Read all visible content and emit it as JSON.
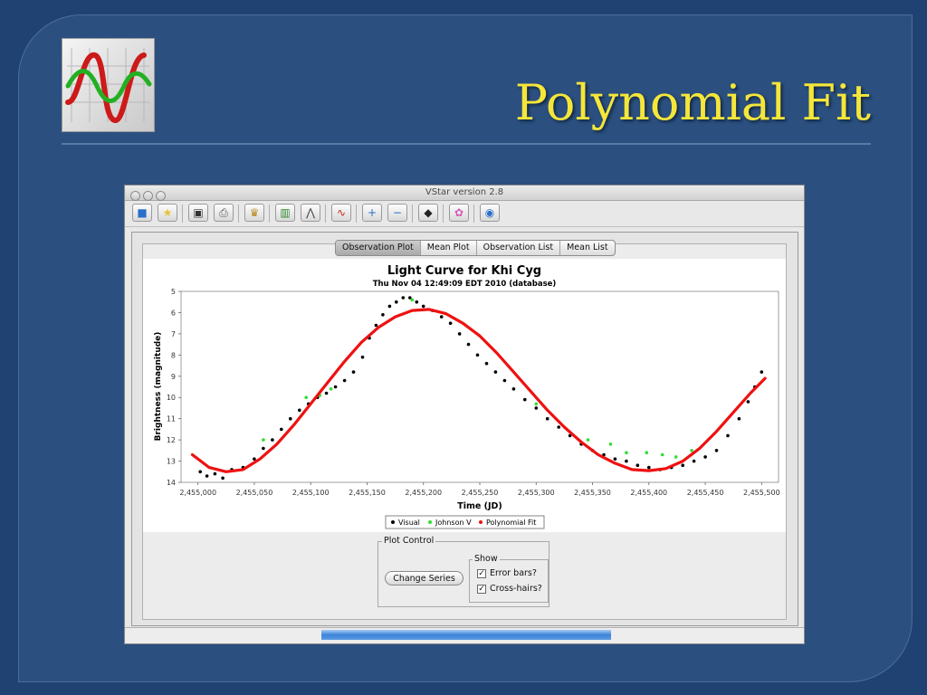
{
  "slide": {
    "title": "Polynomial Fit",
    "logo_icon": "sine-waves-chart-icon"
  },
  "window": {
    "title": "VStar version 2.8",
    "toolbar_icons": [
      "new-star-icon",
      "open-folder-icon",
      "save-icon",
      "print-icon",
      "info-icon",
      "mean-plot-icon",
      "polynomial-icon",
      "wave-icon",
      "zoom-in-icon",
      "zoom-out-icon",
      "filter-icon",
      "plugin-icon",
      "web-icon"
    ],
    "tabs": [
      {
        "label": "Observation Plot",
        "active": true
      },
      {
        "label": "Mean Plot",
        "active": false
      },
      {
        "label": "Observation List",
        "active": false
      },
      {
        "label": "Mean List",
        "active": false
      }
    ],
    "plot_control": {
      "title": "Plot Control",
      "change_series_label": "Change Series",
      "show_title": "Show",
      "error_bars_label": "Error bars?",
      "error_bars_checked": true,
      "cross_hairs_label": "Cross-hairs?",
      "cross_hairs_checked": true
    },
    "progress_fraction": 1.0
  },
  "chart_data": {
    "type": "scatter",
    "title": "Light Curve for Khi Cyg",
    "subtitle": "Thu Nov 04 12:49:09 EDT 2010 (database)",
    "xlabel": "Time (JD)",
    "ylabel": "Brightness (magnitude)",
    "xlim": [
      2454985,
      2455515
    ],
    "ylim": [
      14,
      5
    ],
    "y_inverted": true,
    "x_ticks": [
      "2,455,000",
      "2,455,050",
      "2,455,100",
      "2,455,150",
      "2,455,200",
      "2,455,250",
      "2,455,300",
      "2,455,350",
      "2,455,400",
      "2,455,450",
      "2,455,500"
    ],
    "x_tick_values": [
      2455000,
      2455050,
      2455100,
      2455150,
      2455200,
      2455250,
      2455300,
      2455350,
      2455400,
      2455450,
      2455500
    ],
    "y_ticks": [
      5,
      6,
      7,
      8,
      9,
      10,
      11,
      12,
      13,
      14
    ],
    "grid": false,
    "legend_position": "bottom-center",
    "series": [
      {
        "name": "Visual",
        "color": "#000000",
        "kind": "points",
        "points": [
          [
            2455002,
            13.5
          ],
          [
            2455008,
            13.7
          ],
          [
            2455015,
            13.6
          ],
          [
            2455022,
            13.8
          ],
          [
            2455030,
            13.4
          ],
          [
            2455040,
            13.3
          ],
          [
            2455050,
            12.9
          ],
          [
            2455058,
            12.4
          ],
          [
            2455066,
            12.0
          ],
          [
            2455074,
            11.5
          ],
          [
            2455082,
            11.0
          ],
          [
            2455090,
            10.6
          ],
          [
            2455098,
            10.3
          ],
          [
            2455106,
            10.0
          ],
          [
            2455114,
            9.8
          ],
          [
            2455122,
            9.5
          ],
          [
            2455130,
            9.2
          ],
          [
            2455138,
            8.8
          ],
          [
            2455146,
            8.1
          ],
          [
            2455152,
            7.2
          ],
          [
            2455158,
            6.6
          ],
          [
            2455164,
            6.1
          ],
          [
            2455170,
            5.7
          ],
          [
            2455176,
            5.5
          ],
          [
            2455182,
            5.3
          ],
          [
            2455188,
            5.3
          ],
          [
            2455194,
            5.5
          ],
          [
            2455200,
            5.7
          ],
          [
            2455208,
            5.9
          ],
          [
            2455216,
            6.2
          ],
          [
            2455224,
            6.5
          ],
          [
            2455232,
            7.0
          ],
          [
            2455240,
            7.5
          ],
          [
            2455248,
            8.0
          ],
          [
            2455256,
            8.4
          ],
          [
            2455264,
            8.8
          ],
          [
            2455272,
            9.2
          ],
          [
            2455280,
            9.6
          ],
          [
            2455290,
            10.1
          ],
          [
            2455300,
            10.5
          ],
          [
            2455310,
            11.0
          ],
          [
            2455320,
            11.4
          ],
          [
            2455330,
            11.8
          ],
          [
            2455340,
            12.2
          ],
          [
            2455350,
            12.5
          ],
          [
            2455360,
            12.7
          ],
          [
            2455370,
            12.9
          ],
          [
            2455380,
            13.0
          ],
          [
            2455390,
            13.2
          ],
          [
            2455400,
            13.3
          ],
          [
            2455410,
            13.4
          ],
          [
            2455420,
            13.3
          ],
          [
            2455430,
            13.2
          ],
          [
            2455440,
            13.0
          ],
          [
            2455450,
            12.8
          ],
          [
            2455460,
            12.5
          ],
          [
            2455470,
            11.8
          ],
          [
            2455480,
            11.0
          ],
          [
            2455488,
            10.2
          ],
          [
            2455494,
            9.5
          ],
          [
            2455500,
            8.8
          ]
        ]
      },
      {
        "name": "Johnson V",
        "color": "#33dd33",
        "kind": "points",
        "points": [
          [
            2455058,
            12.0
          ],
          [
            2455096,
            10.0
          ],
          [
            2455108,
            9.9
          ],
          [
            2455118,
            9.6
          ],
          [
            2455190,
            5.4
          ],
          [
            2455300,
            10.3
          ],
          [
            2455346,
            12.0
          ],
          [
            2455366,
            12.2
          ],
          [
            2455380,
            12.6
          ],
          [
            2455398,
            12.6
          ],
          [
            2455412,
            12.7
          ],
          [
            2455424,
            12.8
          ],
          [
            2455438,
            12.5
          ]
        ]
      },
      {
        "name": "Polynomial Fit",
        "color": "#ee1111",
        "kind": "curve",
        "points": [
          [
            2454995,
            12.7
          ],
          [
            2455010,
            13.3
          ],
          [
            2455025,
            13.5
          ],
          [
            2455040,
            13.4
          ],
          [
            2455055,
            12.9
          ],
          [
            2455070,
            12.2
          ],
          [
            2455085,
            11.3
          ],
          [
            2455100,
            10.3
          ],
          [
            2455115,
            9.3
          ],
          [
            2455130,
            8.3
          ],
          [
            2455145,
            7.4
          ],
          [
            2455160,
            6.7
          ],
          [
            2455175,
            6.2
          ],
          [
            2455190,
            5.9
          ],
          [
            2455205,
            5.85
          ],
          [
            2455220,
            6.05
          ],
          [
            2455235,
            6.5
          ],
          [
            2455250,
            7.1
          ],
          [
            2455265,
            7.9
          ],
          [
            2455280,
            8.8
          ],
          [
            2455295,
            9.7
          ],
          [
            2455310,
            10.6
          ],
          [
            2455325,
            11.4
          ],
          [
            2455340,
            12.1
          ],
          [
            2455355,
            12.7
          ],
          [
            2455370,
            13.1
          ],
          [
            2455385,
            13.4
          ],
          [
            2455400,
            13.45
          ],
          [
            2455415,
            13.35
          ],
          [
            2455430,
            13.0
          ],
          [
            2455445,
            12.4
          ],
          [
            2455460,
            11.6
          ],
          [
            2455475,
            10.7
          ],
          [
            2455490,
            9.8
          ],
          [
            2455503,
            9.1
          ]
        ]
      }
    ]
  }
}
